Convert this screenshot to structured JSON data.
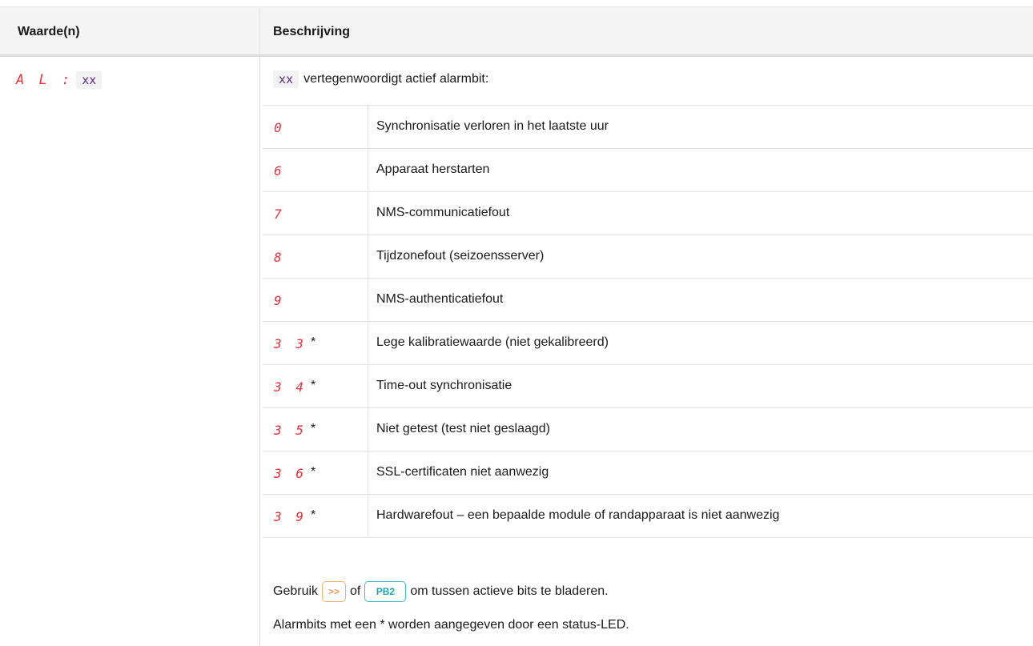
{
  "header": {
    "col1": "Waarde(n)",
    "col2": "Beschrijving"
  },
  "left": {
    "display": "A L :",
    "code": "xx"
  },
  "intro": {
    "code": "xx",
    "text": "vertegenwoordigt actief alarmbit:"
  },
  "rows": [
    {
      "code": "0",
      "star": "",
      "desc": "Synchronisatie verloren in het laatste uur"
    },
    {
      "code": "6",
      "star": "",
      "desc": "Apparaat herstarten"
    },
    {
      "code": "7",
      "star": "",
      "desc": "NMS-communicatiefout"
    },
    {
      "code": "8",
      "star": "",
      "desc": "Tijdzonefout (seizoensserver)"
    },
    {
      "code": "9",
      "star": "",
      "desc": "NMS-authenticatiefout"
    },
    {
      "code": "3 3",
      "star": "*",
      "desc": "Lege kalibratiewaarde (niet gekalibreerd)"
    },
    {
      "code": "3 4",
      "star": "*",
      "desc": "Time-out synchronisatie"
    },
    {
      "code": "3 5",
      "star": "*",
      "desc": "Niet getest (test niet geslaagd)"
    },
    {
      "code": "3 6",
      "star": "*",
      "desc": "SSL-certificaten niet aanwezig"
    },
    {
      "code": "3 9",
      "star": "*",
      "desc": "Hardwarefout – een bepaalde module of randapparaat is niet aanwezig"
    }
  ],
  "footer": {
    "pre": "Gebruik",
    "btn1": ">>",
    "mid": "of",
    "btn2": "PB2",
    "post": "om tussen actieve bits te bladeren.",
    "note": "Alarmbits met een * worden aangegeven door een status-LED."
  }
}
